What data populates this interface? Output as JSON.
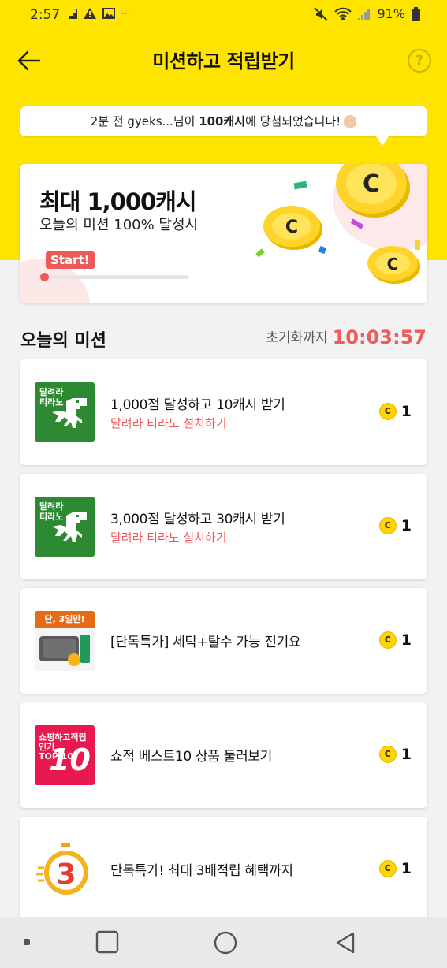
{
  "status_bar": {
    "time": "2:57",
    "battery": "91%"
  },
  "header": {
    "title": "미션하고 적립받기",
    "help": "?"
  },
  "toast": {
    "prefix": "2분 전 gyeks...님이 ",
    "amount": "100캐시",
    "suffix": "에 당첨되었습니다!"
  },
  "hero": {
    "title": "최대 1,000캐시",
    "subtitle": "오늘의 미션 100% 달성시",
    "start": "Start!",
    "progress": 0
  },
  "section": {
    "title": "오늘의 미션",
    "reset_label": "초기화까지",
    "countdown": "10:03:57"
  },
  "missions": [
    {
      "title": "1,000점 달성하고 10캐시 받기",
      "desc": "달려라 티라노 설치하기",
      "reward": "1",
      "thumb_label": "달려라\n티라노"
    },
    {
      "title": "3,000점 달성하고 30캐시 받기",
      "desc": "달려라 티라노 설치하기",
      "reward": "1",
      "thumb_label": "달려라\n티라노"
    },
    {
      "title": "[단독특가] 세탁+탈수 가능 전기요",
      "desc": "",
      "reward": "1",
      "thumb_label": "단, 3일만!"
    },
    {
      "title": "쇼적 베스트10 상품 둘러보기",
      "desc": "",
      "reward": "1",
      "thumb_label": "쇼핑하고적립\n인기\nTOP 10"
    },
    {
      "title": "단독특가! 최대 3배적립 혜택까지",
      "desc": "",
      "reward": "1",
      "thumb_label": "3"
    }
  ],
  "coin_symbol": "C",
  "colors": {
    "brand_yellow": "#ffe400",
    "accent_red": "#f05a5a",
    "coin_yellow": "#ffd400"
  }
}
